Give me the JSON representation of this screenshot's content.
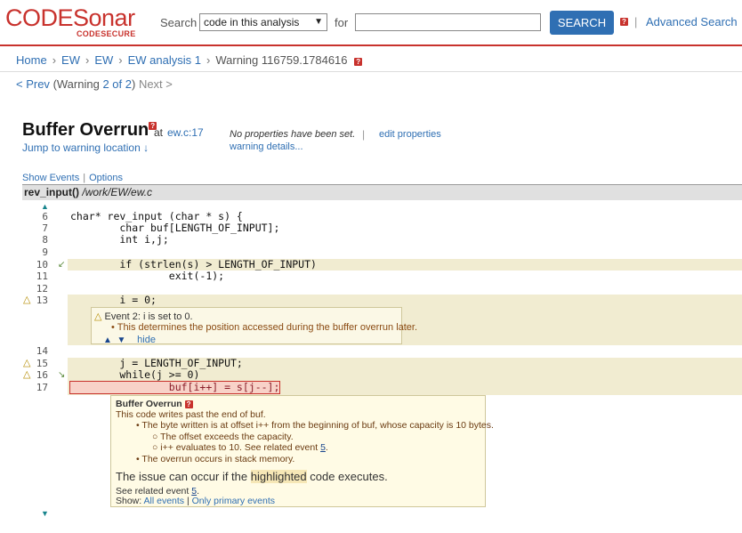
{
  "header": {
    "logo": "CODESonar",
    "logo_sub": "CODESECURE",
    "search_label": "Search",
    "scope_value": "code in this analysis",
    "for_label": "for",
    "query_value": "",
    "search_button": "SEARCH",
    "help_glyph": "?",
    "separator": "|",
    "advanced_search": "Advanced Search"
  },
  "breadcrumb": {
    "items": [
      "Home",
      "EW",
      "EW",
      "EW analysis 1",
      "Warning 116759.1784616"
    ],
    "sep": "›"
  },
  "prevnext": {
    "prev": "< Prev",
    "open": "(Warning ",
    "current": "2 of 2",
    "close": ")",
    "next": "Next >"
  },
  "warning": {
    "title": "Buffer Overrun",
    "at_label": "at",
    "location": "ew.c:17",
    "jump": "Jump to warning location ↓",
    "no_props": "No properties have been set.",
    "props_sep": "|",
    "edit_props": "edit properties",
    "details": "warning details..."
  },
  "options": {
    "show_events": "Show Events",
    "sep": "|",
    "options": "Options"
  },
  "function_bar": {
    "name": "rev_input()",
    "path": "/work/EW/ew.c"
  },
  "code": {
    "lines": [
      {
        "n": "6",
        "text": "char* rev_input (char * s) {"
      },
      {
        "n": "7",
        "text": "        char buf[LENGTH_OF_INPUT];"
      },
      {
        "n": "8",
        "text": "        int i,j;"
      },
      {
        "n": "9",
        "text": ""
      },
      {
        "n": "10",
        "text": "        if (strlen(s) > LENGTH_OF_INPUT)"
      },
      {
        "n": "11",
        "text": "                exit(-1);"
      },
      {
        "n": "12",
        "text": ""
      },
      {
        "n": "13",
        "text": "        i = 0;"
      },
      {
        "n": "14",
        "text": ""
      },
      {
        "n": "15",
        "text": "        j = LENGTH_OF_INPUT;"
      },
      {
        "n": "16",
        "text": "        while(j >= 0)"
      },
      {
        "n": "17",
        "text": "                buf[i++] = s[j--];"
      }
    ]
  },
  "event2": {
    "label": "Event 2:",
    "title": "i is set to 0.",
    "bullet": "This determines the position accessed during the buffer overrun later.",
    "nav_up": "▲",
    "nav_down": "▼",
    "hide": "hide"
  },
  "overrun_box": {
    "title": "Buffer Overrun",
    "desc": "This code writes past the end of buf.",
    "b1": "The byte written is at offset i++ from the beginning of buf, whose capacity is 10 bytes.",
    "b1a": "The offset exceeds the capacity.",
    "b1b_pre": "i++ evaluates to 10.  See related event ",
    "b1b_link": "5",
    "b1b_post": ".",
    "b2": "The overrun occurs in stack memory.",
    "big_pre": "The issue can occur if the ",
    "big_hl": "highlighted",
    "big_post": " code executes.",
    "related_pre": "See related event ",
    "related_link": "5",
    "related_post": ".",
    "show_label": "Show:",
    "all_events": "All events",
    "show_sep": "|",
    "primary_events": "Only primary events"
  },
  "colors": {
    "brand": "#c8322d",
    "link": "#2f6fb3",
    "highlight_row": "#f1ecd1",
    "event_bg": "#fbf8e6"
  }
}
